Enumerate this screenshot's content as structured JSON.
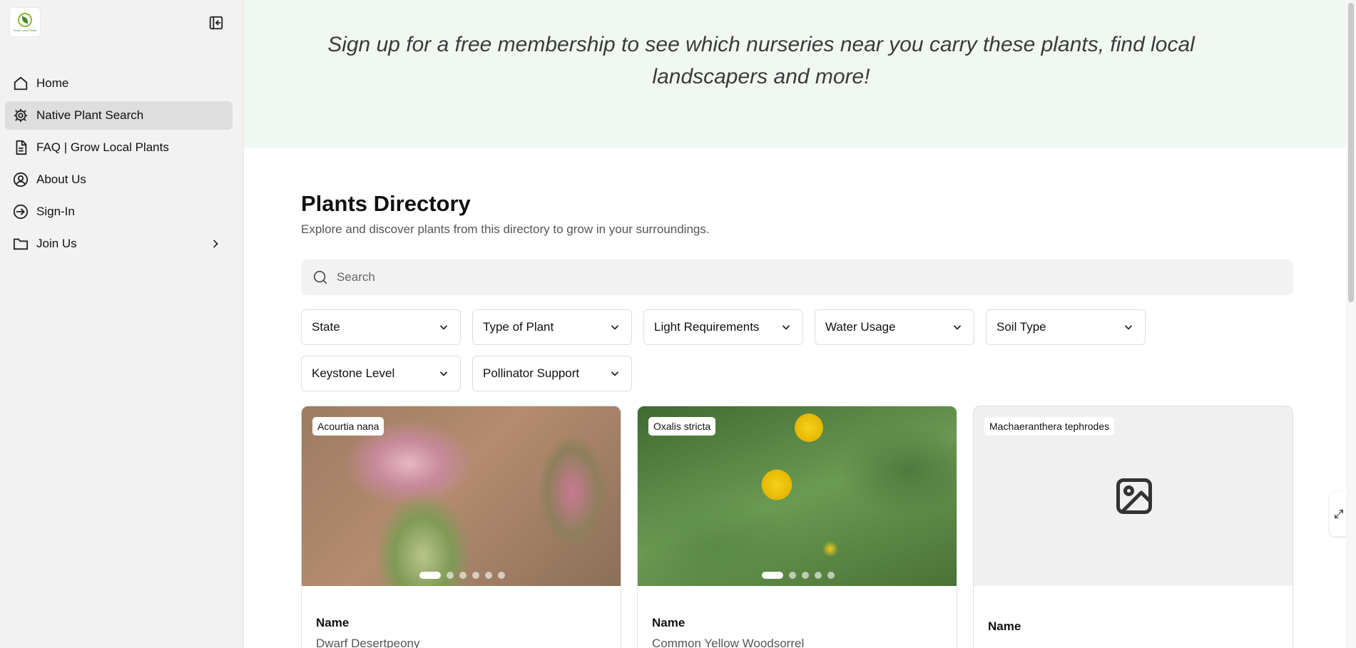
{
  "sidebar": {
    "logo_text": "Grow Local Plants",
    "items": [
      {
        "label": "Home",
        "icon": "home-icon"
      },
      {
        "label": "Native Plant Search",
        "icon": "gear-icon"
      },
      {
        "label": "FAQ | Grow Local Plants",
        "icon": "document-icon"
      },
      {
        "label": "About Us",
        "icon": "user-circle-icon"
      },
      {
        "label": "Sign-In",
        "icon": "sign-in-icon"
      },
      {
        "label": "Join Us",
        "icon": "folder-icon"
      }
    ]
  },
  "banner": {
    "text": "Sign up for a free membership to see which nurseries near you carry these plants, find local landscapers and more!"
  },
  "directory": {
    "title": "Plants Directory",
    "subtitle": "Explore and discover plants from this directory to grow in your surroundings."
  },
  "search": {
    "placeholder": "Search",
    "value": ""
  },
  "filters": [
    {
      "label": "State"
    },
    {
      "label": "Type of Plant"
    },
    {
      "label": "Light Requirements"
    },
    {
      "label": "Water Usage"
    },
    {
      "label": "Soil Type"
    },
    {
      "label": "Keystone Level"
    },
    {
      "label": "Pollinator Support"
    }
  ],
  "cards": [
    {
      "tag": "Acourtia nana",
      "label": "Name",
      "value": "Dwarf Desertpeony"
    },
    {
      "tag": "Oxalis stricta",
      "label": "Name",
      "value": "Common Yellow Woodsorrel"
    },
    {
      "tag": "Machaeranthera tephrodes",
      "label": "Name",
      "value": ""
    }
  ],
  "colors": {
    "banner_bg": "#f1f8f2",
    "sidebar_bg": "#f2f2f2",
    "active_item_bg": "#dedede"
  }
}
